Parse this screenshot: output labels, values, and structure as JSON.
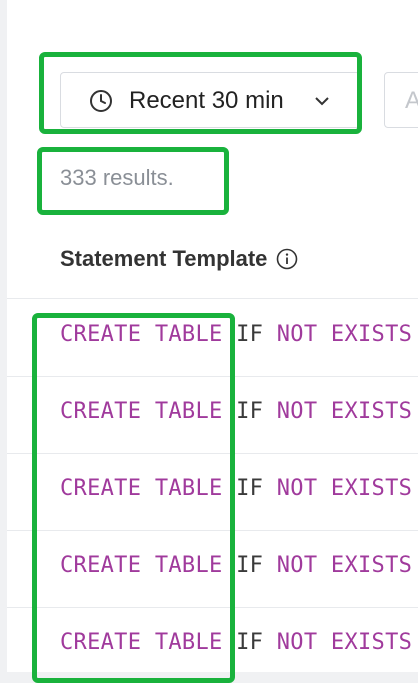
{
  "filters": {
    "time_range_label": "Recent 30 min",
    "second_control_text": "A"
  },
  "results_summary": "333 results.",
  "table": {
    "column_header": "Statement Template",
    "rows": [
      {
        "kw1": "CREATE TABLE",
        "t1": "IF",
        "kw2": "NOT EXISTS"
      },
      {
        "kw1": "CREATE TABLE",
        "t1": "IF",
        "kw2": "NOT EXISTS"
      },
      {
        "kw1": "CREATE TABLE",
        "t1": "IF",
        "kw2": "NOT EXISTS"
      },
      {
        "kw1": "CREATE TABLE",
        "t1": "IF",
        "kw2": "NOT EXISTS"
      },
      {
        "kw1": "CREATE TABLE",
        "t1": "IF",
        "kw2": "NOT EXISTS"
      }
    ]
  },
  "colors": {
    "highlight": "#19b23c",
    "sql_keyword": "#a03a9c"
  },
  "icons": {
    "time_picker": "clock-icon",
    "dropdown": "chevron-down-icon",
    "header_info": "info-icon"
  }
}
